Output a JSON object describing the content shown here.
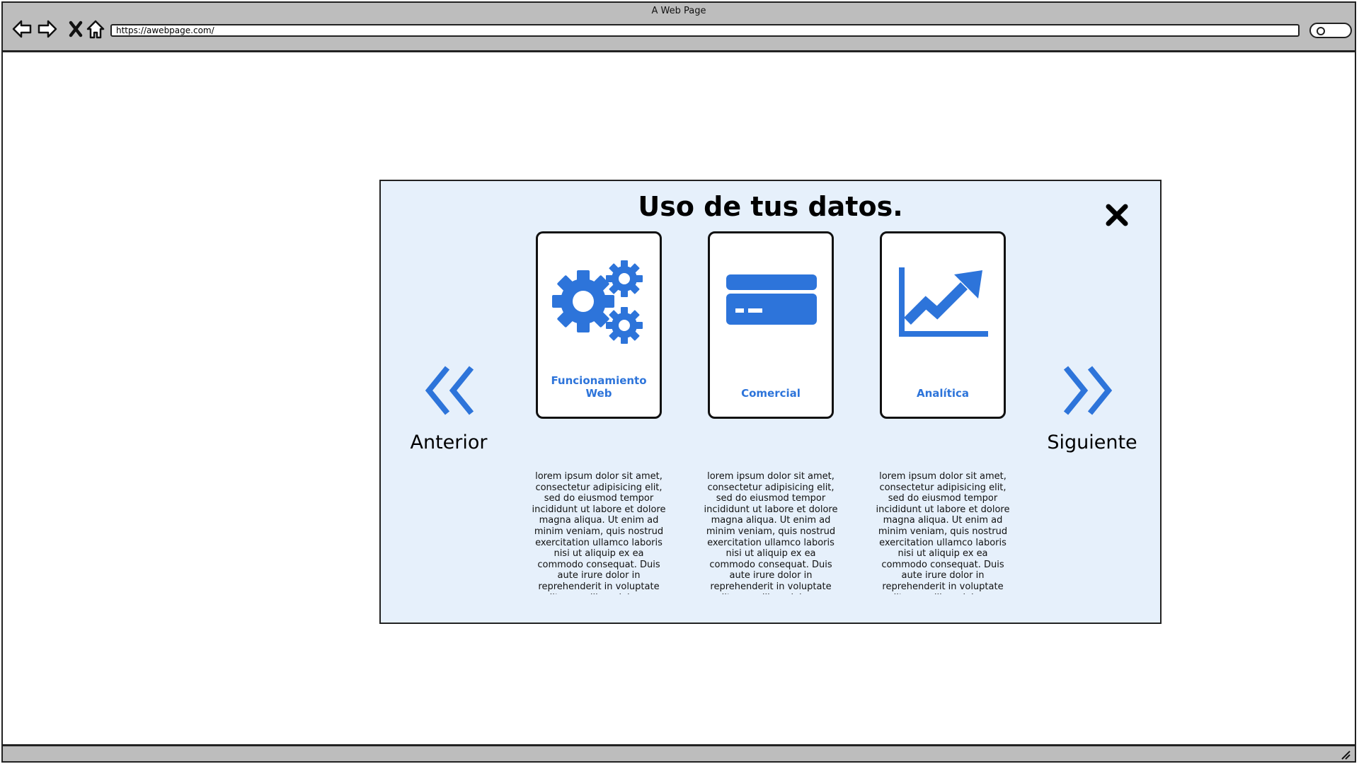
{
  "window": {
    "title": "A Web Page",
    "url": "https://awebpage.com/"
  },
  "modal": {
    "title": "Uso de tus datos.",
    "prev_label": "Anterior",
    "next_label": "Siguiente",
    "cards": [
      {
        "label": "Funcionamiento Web",
        "icon": "gears-icon",
        "description": "lorem ipsum dolor sit amet, consectetur adipisicing elit, sed do eiusmod tempor incididunt ut labore et dolore magna aliqua. Ut enim ad minim veniam, quis nostrud exercitation ullamco laboris nisi ut aliquip ex ea commodo consequat. Duis aute irure dolor in reprehenderit in voluptate velit esse cillum dolore eu fugiat nulla pariatur."
      },
      {
        "label": "Comercial",
        "icon": "credit-card-icon",
        "description": "lorem ipsum dolor sit amet, consectetur adipisicing elit, sed do eiusmod tempor incididunt ut labore et dolore magna aliqua. Ut enim ad minim veniam, quis nostrud exercitation ullamco laboris nisi ut aliquip ex ea commodo consequat. Duis aute irure dolor in reprehenderit in voluptate velit esse cillum dolore eu fugiat nulla pariatur."
      },
      {
        "label": "Analítica",
        "icon": "line-chart-icon",
        "description": "lorem ipsum dolor sit amet, consectetur adipisicing elit, sed do eiusmod tempor incididunt ut labore et dolore magna aliqua. Ut enim ad minim veniam, quis nostrud exercitation ullamco laboris nisi ut aliquip ex ea commodo consequat. Duis aute irure dolor in reprehenderit in voluptate velit esse cillum dolore eu fugiat nulla pariatur."
      }
    ]
  },
  "colors": {
    "accent": "#2d74da",
    "modal_bg": "#e6f0fb",
    "chrome": "#bdbdbd"
  }
}
